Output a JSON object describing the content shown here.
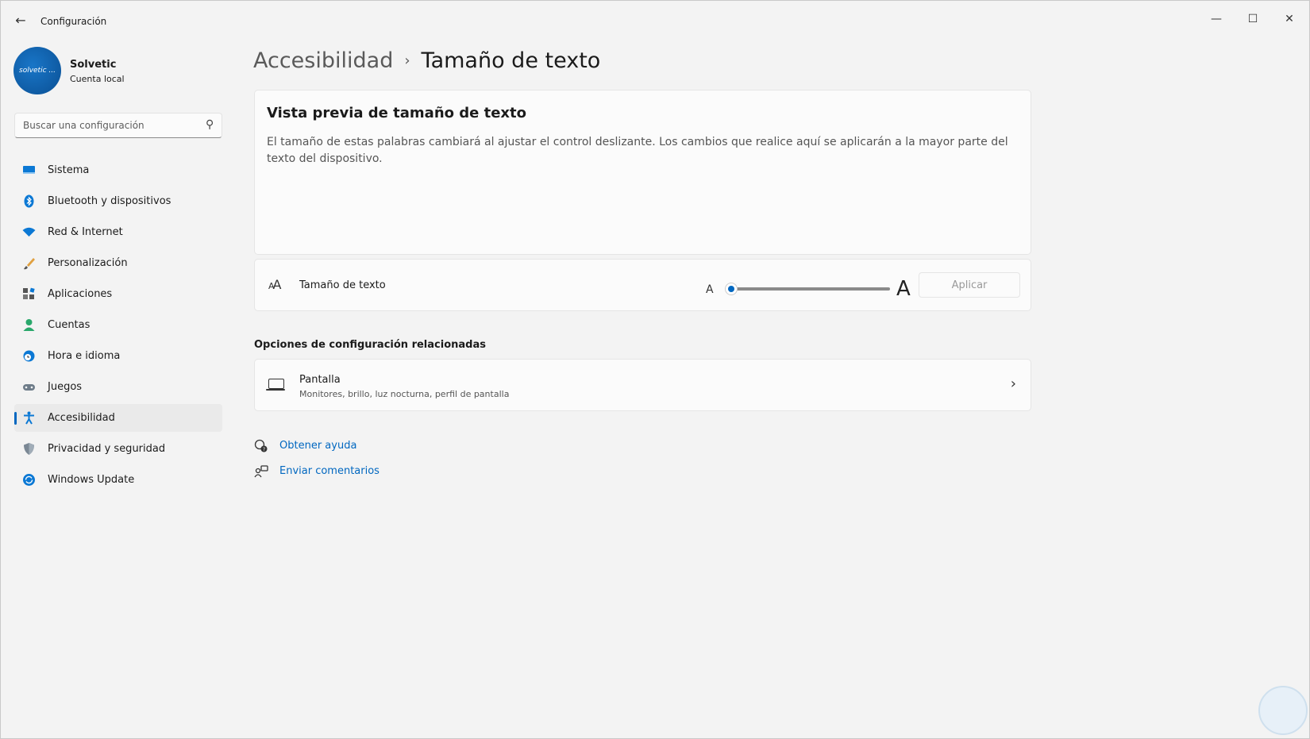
{
  "window": {
    "app_title": "Configuración",
    "back_icon": "arrow-left-icon",
    "controls": {
      "minimize": "—",
      "maximize": "☐",
      "close": "✕"
    }
  },
  "user": {
    "name": "Solvetic",
    "account_type": "Cuenta local",
    "avatar_text": "solvetic ..."
  },
  "search": {
    "placeholder": "Buscar una configuración",
    "icon": "search-icon"
  },
  "sidebar": {
    "items": [
      {
        "label": "Sistema",
        "icon": "system-icon"
      },
      {
        "label": "Bluetooth y dispositivos",
        "icon": "bluetooth-icon"
      },
      {
        "label": "Red & Internet",
        "icon": "wifi-icon"
      },
      {
        "label": "Personalización",
        "icon": "brush-icon"
      },
      {
        "label": "Aplicaciones",
        "icon": "apps-icon"
      },
      {
        "label": "Cuentas",
        "icon": "person-icon"
      },
      {
        "label": "Hora e idioma",
        "icon": "globe-clock-icon"
      },
      {
        "label": "Juegos",
        "icon": "gamepad-icon"
      },
      {
        "label": "Accesibilidad",
        "icon": "accessibility-icon",
        "active": true
      },
      {
        "label": "Privacidad y seguridad",
        "icon": "shield-icon"
      },
      {
        "label": "Windows Update",
        "icon": "refresh-icon"
      }
    ]
  },
  "breadcrumb": {
    "parent": "Accesibilidad",
    "separator": "›",
    "current": "Tamaño de texto"
  },
  "preview": {
    "title": "Vista previa de tamaño de texto",
    "body": "El tamaño de estas palabras cambiará al ajustar el control deslizante. Los cambios que realice aquí se aplicarán a la mayor parte del texto del dispositivo."
  },
  "text_size": {
    "label": "Tamaño de texto",
    "small_marker": "A",
    "large_marker": "A",
    "slider_value_fraction": 0.0,
    "apply_label": "Aplicar",
    "accent": "#0067c0"
  },
  "related": {
    "heading": "Opciones de configuración relacionadas",
    "display": {
      "title": "Pantalla",
      "subtitle": "Monitores, brillo, luz nocturna, perfil de pantalla"
    }
  },
  "links": {
    "help": "Obtener ayuda",
    "feedback": "Enviar comentarios"
  }
}
